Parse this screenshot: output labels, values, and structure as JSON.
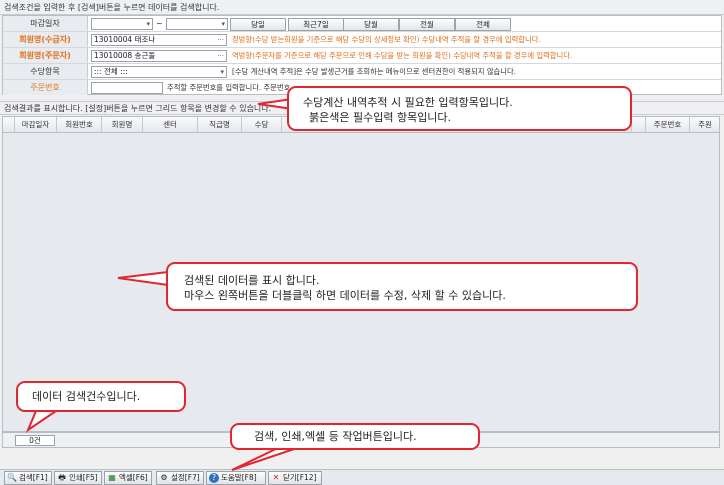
{
  "header_text": "검색조건을 입력한 후 [검색]버튼을 누르면 데이터를 검색합니다.",
  "form": {
    "date_label": "마감일자",
    "date_from": "",
    "date_sep": "~",
    "date_to": "",
    "date_buttons": [
      "당일",
      "최근7일",
      "당월",
      "전월",
      "전체"
    ],
    "payee_label": "회원명(수급자)",
    "payee_value": "13010004 태조나",
    "payee_note": "정방향(수당 받는회원을 기준으로 해당 수당의 상세정보 확인) 수당내역 추적을 할 경우에 입력합니다.",
    "orderer_label": "회원명(주문자)",
    "orderer_value": "13010008 송근돌",
    "orderer_note": "역방향(주문자를 기준으로 해당 주문으로 인해 수당을 받는 회원을 확인) 수당내역 추적을 할 경우에 입력합니다.",
    "allowance_label": "수당항목",
    "allowance_value": "::: 전체 :::",
    "allowance_note": "[수당 계산내역 추적]은 수당 발생근거를 조회하는 메뉴이므로 센터권한이 적용되지 않습니다.",
    "order_label": "주문번호",
    "order_value": "",
    "order_note": "추적할 주문번호를 입력합니다. 주문번호"
  },
  "results_header": "검색결과를 표시합니다. [설정]버튼을 누르면 그리드 항목을 변경할 수 있습니다.",
  "grid": {
    "columns": [
      "마감일자",
      "회원번호",
      "회원명",
      "센터",
      "직급명",
      "수당",
      "",
      "",
      "",
      "",
      "",
      "",
      "",
      "",
      "",
      "주문번호",
      "주원"
    ]
  },
  "count": "0건",
  "toolbar": [
    {
      "label": "검색[F1]",
      "icon": "search-icon"
    },
    {
      "label": "인쇄[F5]",
      "icon": "print-icon"
    },
    {
      "label": "엑셀[F6]",
      "icon": "excel-icon"
    },
    {
      "label": "설정[F7]",
      "icon": "settings-icon"
    },
    {
      "label": "도움말[F8]",
      "icon": "help-icon"
    },
    {
      "label": "닫기[F12]",
      "icon": "close-icon"
    }
  ],
  "callouts": {
    "input_line1": "수당계산 내역추적 시 필요한 입력항목입니다.",
    "input_line2": "붉은색은 필수입력 항목입니다.",
    "grid_line1": "검색된 데이터를 표시 합니다.",
    "grid_line2": "마우스 왼쪽버튼을 더블클릭 하면 데이터를 수정, 삭제 할 수 있습니다.",
    "count_text": "데이터 검색건수입니다.",
    "toolbar_text": "검색, 인쇄,엑셀 등 작업버튼입니다."
  },
  "colors": {
    "required": "#e06d16",
    "callout_border": "#e0262f"
  }
}
